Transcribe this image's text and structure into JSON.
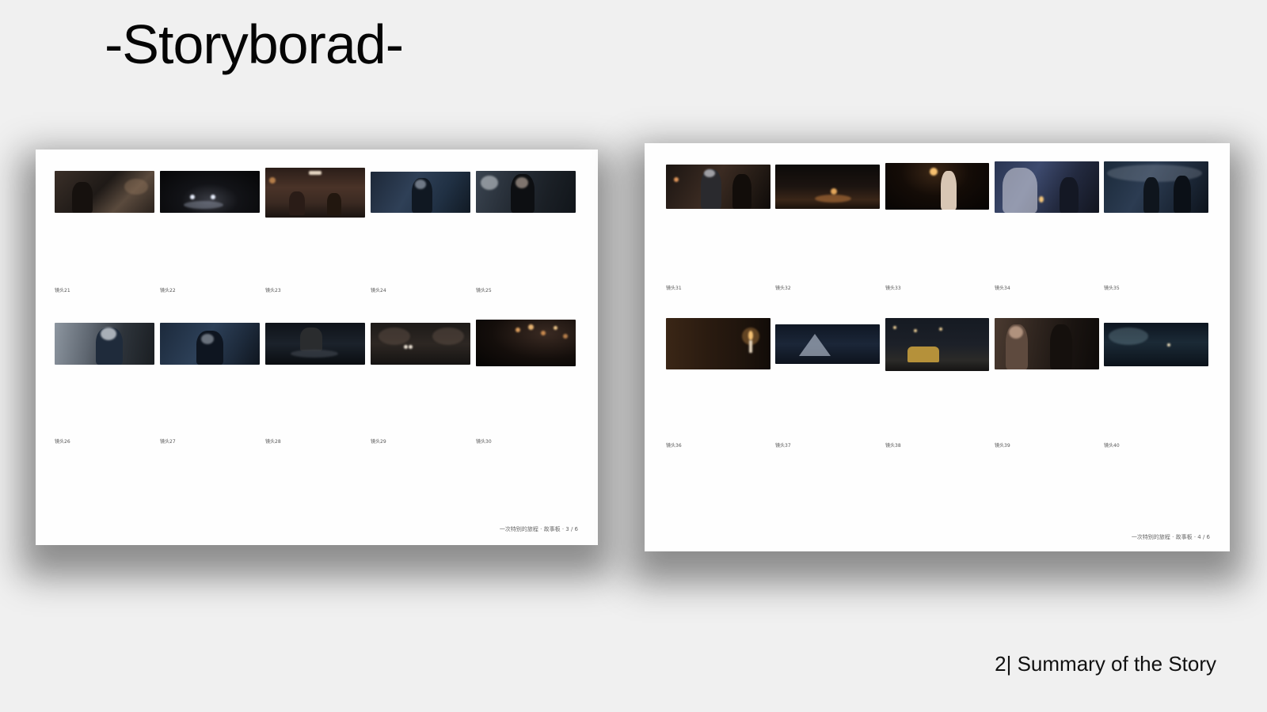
{
  "title": "-Storyborad-",
  "footer": "2| Summary of the Story",
  "sheets": [
    {
      "page_footer": "一次特别的旅程 · 故事板 · 3 / 6",
      "shots": [
        "镜头21",
        "镜头22",
        "镜头23",
        "镜头24",
        "镜头25",
        "镜头26",
        "镜头27",
        "镜头28",
        "镜头29",
        "镜头30"
      ]
    },
    {
      "page_footer": "一次特别的旅程 · 故事板 · 4 / 6",
      "shots": [
        "镜头31",
        "镜头32",
        "镜头33",
        "镜头34",
        "镜头35",
        "镜头36",
        "镜头37",
        "镜头38",
        "镜头39",
        "镜头40"
      ]
    }
  ]
}
